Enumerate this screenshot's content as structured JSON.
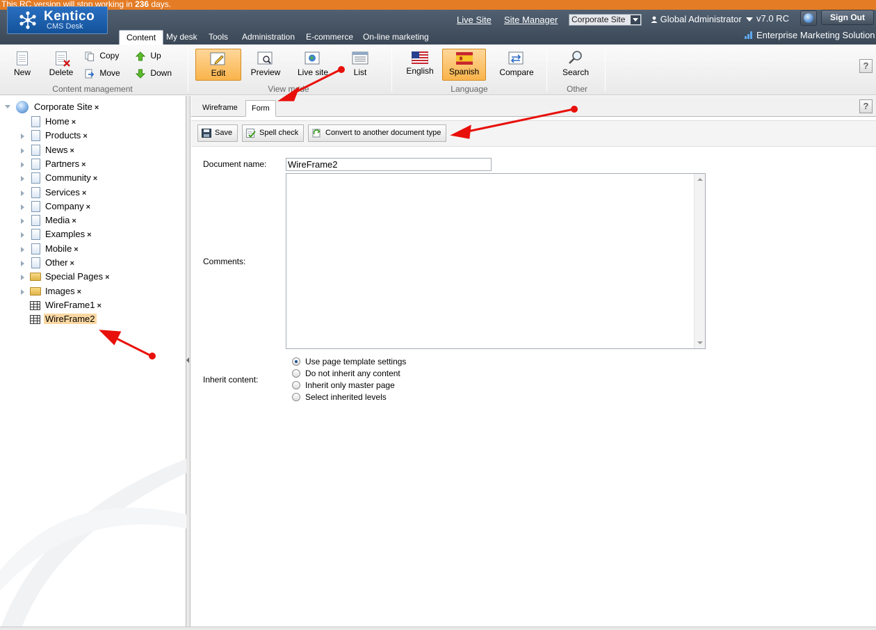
{
  "banner": {
    "text_prefix": "This RC version will stop working in ",
    "days": "236",
    "text_suffix": " days."
  },
  "header": {
    "logo_name": "Kentico",
    "logo_sub": "CMS Desk",
    "main_tabs": [
      {
        "label": "Content",
        "active": true
      },
      {
        "label": "My desk"
      },
      {
        "label": "Tools"
      },
      {
        "label": "Administration"
      },
      {
        "label": "E-commerce"
      },
      {
        "label": "On-line marketing"
      }
    ],
    "links": {
      "live_site": "Live Site",
      "site_manager": "Site Manager"
    },
    "site_selector": "Corporate Site",
    "user": "Global Administrator",
    "version": "v7.0 RC",
    "sign_out": "Sign Out",
    "edition": "Enterprise Marketing Solution"
  },
  "ribbon": {
    "content_management": {
      "label": "Content management",
      "new": "New",
      "delete": "Delete",
      "copy": "Copy",
      "move": "Move",
      "up": "Up",
      "down": "Down"
    },
    "view_mode": {
      "label": "View mode",
      "edit": "Edit",
      "preview": "Preview",
      "live_site": "Live site",
      "list": "List",
      "selected": "Edit"
    },
    "language": {
      "label": "Language",
      "english": "English",
      "spanish": "Spanish",
      "compare": "Compare",
      "selected": "Spanish"
    },
    "other": {
      "label": "Other",
      "search": "Search"
    },
    "help": "?"
  },
  "tree": {
    "root": "Corporate Site",
    "items": [
      {
        "label": "Home",
        "icon": "page-icon",
        "expandable": false
      },
      {
        "label": "Products",
        "icon": "page-icon",
        "expandable": true
      },
      {
        "label": "News",
        "icon": "page-icon",
        "expandable": true
      },
      {
        "label": "Partners",
        "icon": "page-icon",
        "expandable": true
      },
      {
        "label": "Community",
        "icon": "page-icon",
        "expandable": true
      },
      {
        "label": "Services",
        "icon": "page-icon",
        "expandable": true
      },
      {
        "label": "Company",
        "icon": "page-icon",
        "expandable": true
      },
      {
        "label": "Media",
        "icon": "page-icon",
        "expandable": true
      },
      {
        "label": "Examples",
        "icon": "page-icon",
        "expandable": true
      },
      {
        "label": "Mobile",
        "icon": "page-icon",
        "expandable": true
      },
      {
        "label": "Other",
        "icon": "page-icon",
        "expandable": true
      },
      {
        "label": "Special Pages",
        "icon": "folder-icon",
        "expandable": true
      },
      {
        "label": "Images",
        "icon": "folder-icon",
        "expandable": true
      },
      {
        "label": "WireFrame1",
        "icon": "grid-icon",
        "expandable": false
      },
      {
        "label": "WireFrame2",
        "icon": "grid-icon",
        "expandable": false,
        "selected": true
      }
    ],
    "delete_glyph": "×"
  },
  "editor": {
    "tabs": [
      {
        "label": "Wireframe"
      },
      {
        "label": "Form",
        "active": true
      }
    ],
    "actions": {
      "save": "Save",
      "spell_check": "Spell check",
      "convert": "Convert to another document type"
    },
    "fields": {
      "document_name_label": "Document name:",
      "document_name_value": "WireFrame2",
      "comments_label": "Comments:",
      "comments_value": "",
      "inherit_label": "Inherit content:",
      "inherit_options": [
        {
          "label": "Use page template settings",
          "checked": true
        },
        {
          "label": "Do not inherit any content"
        },
        {
          "label": "Inherit only master page"
        },
        {
          "label": "Select inherited levels"
        }
      ]
    }
  },
  "colors": {
    "banner": "#e47c25",
    "header": "#3a4756",
    "selected_button": "#f9b44b",
    "annotation_arrow": "#e8100a"
  }
}
